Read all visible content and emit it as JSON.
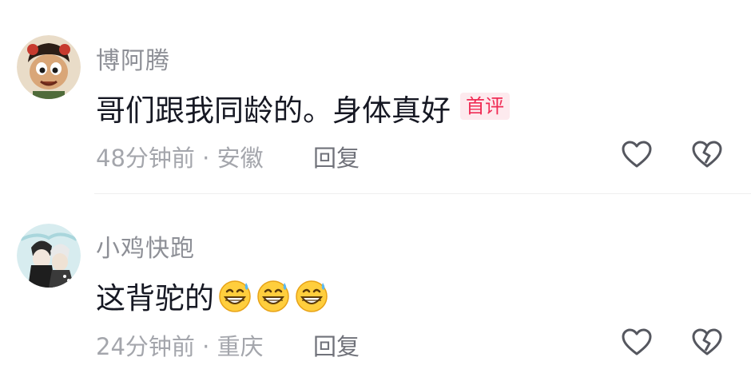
{
  "comments": [
    {
      "username": "博阿腾",
      "text": "哥们跟我同龄的。身体真好",
      "badge": "首评",
      "time": "48分钟前",
      "location": "安徽",
      "reply_label": "回复",
      "avatar": "cartoon-boy-avatar"
    },
    {
      "username": "小鸡快跑",
      "text": "这背驼的",
      "emojis": [
        "grinning-sweat-emoji",
        "grinning-sweat-emoji",
        "grinning-sweat-emoji"
      ],
      "time": "24分钟前",
      "location": "重庆",
      "reply_label": "回复",
      "avatar": "anime-photo-avatar"
    }
  ],
  "meta_separator": " · ",
  "icons": {
    "like": "heart-outline-icon",
    "dislike": "broken-heart-icon"
  },
  "colors": {
    "username": "#8d8f96",
    "text": "#161823",
    "meta": "#a4a6ac",
    "badge_text": "#f02c55",
    "badge_bg": "#fdeaee"
  }
}
